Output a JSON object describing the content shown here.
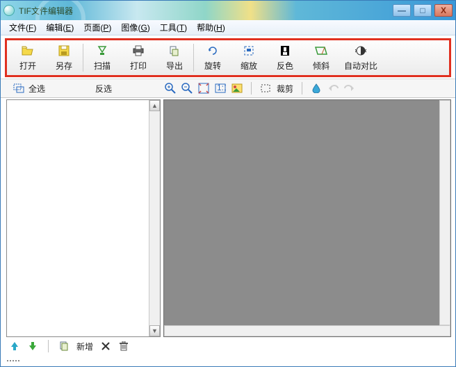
{
  "title": "TIF文件编辑器",
  "window_controls": {
    "min": "—",
    "max": "□",
    "close": "X"
  },
  "menu": [
    {
      "label": "文件",
      "hotkey": "F"
    },
    {
      "label": "编辑",
      "hotkey": "E"
    },
    {
      "label": "页面",
      "hotkey": "P"
    },
    {
      "label": "图像",
      "hotkey": "G"
    },
    {
      "label": "工具",
      "hotkey": "T"
    },
    {
      "label": "帮助",
      "hotkey": "H"
    }
  ],
  "toolbar": [
    {
      "name": "open",
      "label": "打开"
    },
    {
      "name": "saveas",
      "label": "另存"
    },
    {
      "name": "scan",
      "label": "扫描"
    },
    {
      "name": "print",
      "label": "打印"
    },
    {
      "name": "export",
      "label": "导出"
    },
    {
      "name": "rotate",
      "label": "旋转"
    },
    {
      "name": "zoom",
      "label": "缩放"
    },
    {
      "name": "invert",
      "label": "反色"
    },
    {
      "name": "skew",
      "label": "倾斜"
    },
    {
      "name": "autocontrast",
      "label": "自动对比"
    }
  ],
  "secondary": {
    "select_all": "全选",
    "invert_sel": "反选",
    "crop": "裁剪"
  },
  "bottom": {
    "new": "新增"
  }
}
